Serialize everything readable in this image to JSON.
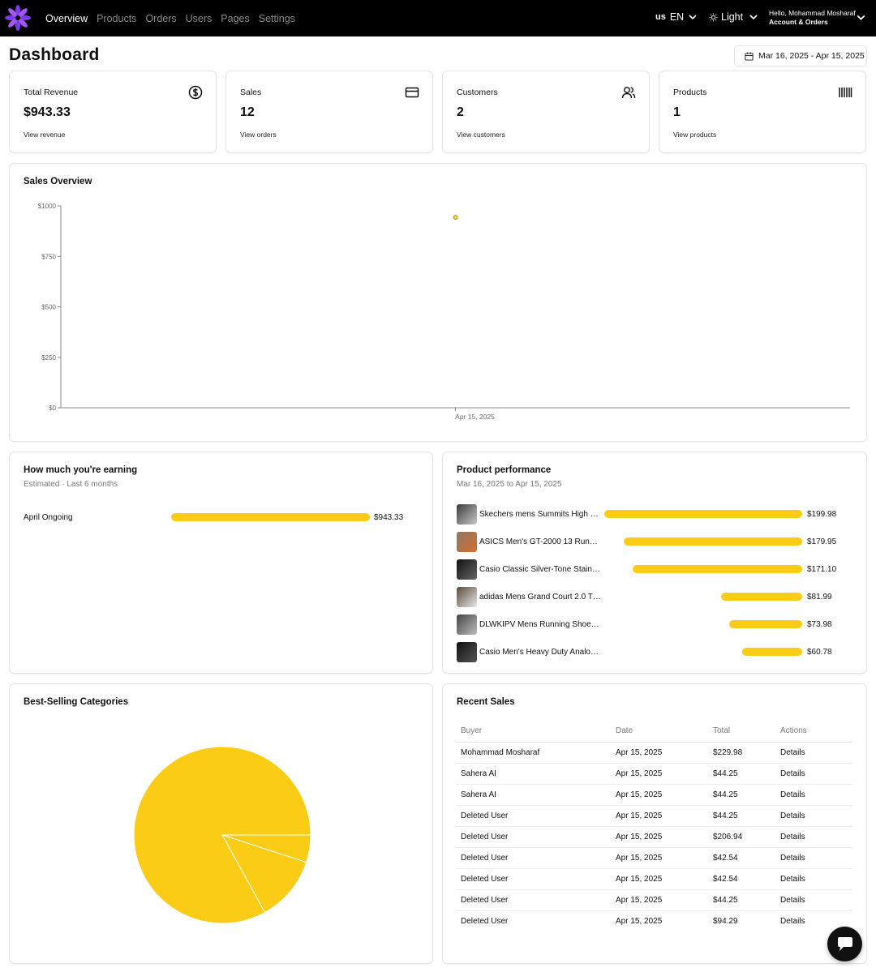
{
  "nav": {
    "links": [
      {
        "label": "Overview",
        "active": true
      },
      {
        "label": "Products",
        "active": false
      },
      {
        "label": "Orders",
        "active": false
      },
      {
        "label": "Users",
        "active": false
      },
      {
        "label": "Pages",
        "active": false
      },
      {
        "label": "Settings",
        "active": false
      }
    ],
    "lang_flag": "us",
    "lang_label": "EN",
    "theme_label": "Light",
    "greeting": "Hello, Mohammad Mosharaf",
    "account_label": "Account & Orders"
  },
  "page": {
    "title": "Dashboard",
    "date_range": "Mar 16, 2025 - Apr 15, 2025"
  },
  "stats": [
    {
      "label": "Total Revenue",
      "value": "$943.33",
      "link": "View revenue",
      "icon": "dollar-circle-icon"
    },
    {
      "label": "Sales",
      "value": "12",
      "link": "View orders",
      "icon": "credit-card-icon"
    },
    {
      "label": "Customers",
      "value": "2",
      "link": "View customers",
      "icon": "users-icon"
    },
    {
      "label": "Products",
      "value": "1",
      "link": "View products",
      "icon": "barcode-icon"
    }
  ],
  "sales_overview": {
    "title": "Sales Overview"
  },
  "chart_data": {
    "type": "scatter",
    "title": "Sales Overview",
    "x": [
      "Apr 15, 2025"
    ],
    "values": [
      943.33
    ],
    "ylim": [
      0,
      1000
    ],
    "yticks": [
      "$0",
      "$250",
      "$500",
      "$750",
      "$1000"
    ],
    "yticks_values": [
      0,
      250,
      500,
      750,
      1000
    ],
    "grid": false,
    "color": "#ca8a04"
  },
  "earning": {
    "title": "How much you're earning",
    "subtitle": "Estimated · Last 6 months",
    "rows": [
      {
        "label": "April Ongoing",
        "value": "$943.33",
        "fraction": 1.0
      }
    ]
  },
  "performance": {
    "title": "Product performance",
    "subtitle": "Mar 16, 2025 to Apr 15, 2025",
    "rows": [
      {
        "name": "Skechers mens Summits High …",
        "value": "$199.98",
        "fraction": 1.0
      },
      {
        "name": "ASICS Men's GT-2000 13 Run…",
        "value": "$179.95",
        "fraction": 0.9
      },
      {
        "name": "Casio Classic Silver-Tone Stain…",
        "value": "$171.10",
        "fraction": 0.856
      },
      {
        "name": "adidas Mens Grand Court 2.0 T…",
        "value": "$81.99",
        "fraction": 0.41
      },
      {
        "name": "DLWKIPV Mens Running Shoe…",
        "value": "$73.98",
        "fraction": 0.37
      },
      {
        "name": "Casio Men's Heavy Duty Analo…",
        "value": "$60.78",
        "fraction": 0.304
      }
    ]
  },
  "categories": {
    "title": "Best-Selling Categories",
    "slices": [
      0.05,
      0.12,
      0.83
    ],
    "color": "#facc15"
  },
  "recent_sales": {
    "title": "Recent Sales",
    "columns": [
      "Buyer",
      "Date",
      "Total",
      "Actions"
    ],
    "rows": [
      [
        "Mohammad Mosharaf",
        "Apr 15, 2025",
        "$229.98",
        "Details"
      ],
      [
        "Sahera AI",
        "Apr 15, 2025",
        "$44.25",
        "Details"
      ],
      [
        "Sahera AI",
        "Apr 15, 2025",
        "$44.25",
        "Details"
      ],
      [
        "Deleted User",
        "Apr 15, 2025",
        "$44.25",
        "Details"
      ],
      [
        "Deleted User",
        "Apr 15, 2025",
        "$206.94",
        "Details"
      ],
      [
        "Deleted User",
        "Apr 15, 2025",
        "$42.54",
        "Details"
      ],
      [
        "Deleted User",
        "Apr 15, 2025",
        "$42.54",
        "Details"
      ],
      [
        "Deleted User",
        "Apr 15, 2025",
        "$44.25",
        "Details"
      ],
      [
        "Deleted User",
        "Apr 15, 2025",
        "$94.29",
        "Details"
      ]
    ]
  }
}
